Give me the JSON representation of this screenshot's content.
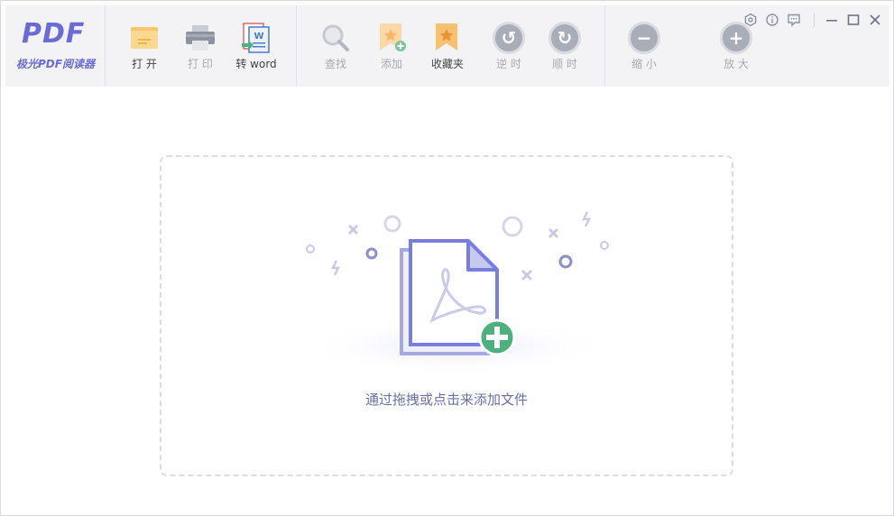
{
  "app": {
    "logo_text": "PDF",
    "logo_subtitle": "极光PDF阅读器"
  },
  "toolbar": {
    "open_label": "打 开",
    "print_label": "打 印",
    "to_word_label": "转 word",
    "find_label": "查找",
    "add_label": "添加",
    "favorites_label": "收藏夹",
    "rotate_ccw_label": "逆 时",
    "rotate_cw_label": "顺 时",
    "zoom_out_label": "缩 小",
    "zoom_in_label": "放 大"
  },
  "dropzone": {
    "hint": "通过拖拽或点击来添加文件"
  },
  "colors": {
    "accent": "#6b6bd6",
    "toolbar_bg": "#f3f3f6",
    "add_badge": "#4fb07f"
  }
}
